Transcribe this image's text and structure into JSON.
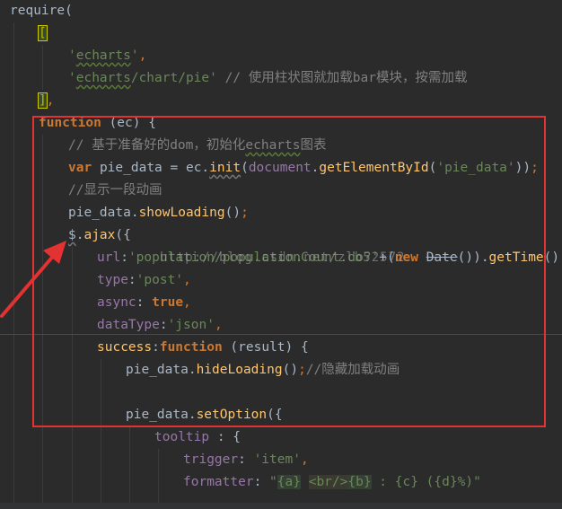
{
  "lines": [
    "require(",
    "[",
    "'echarts',",
    "'echarts/chart/pie' // 使用柱状图就加载bar模块，按需加载",
    "],",
    "function (ec) {",
    "// 基于准备好的dom，初始化echarts图表",
    "var pie_data = ec.init(document.getElementById('pie_data'));",
    "//显示一段动画",
    "pie_data.showLoading();",
    "$.ajax({",
    "url:'population/populationCount.do?'+(new Date()).getTime(),",
    "type:'post',",
    "async: true,",
    "dataType:'json',",
    "success:function (result) {",
    "pie_data.hideLoading();//隐藏加载动画",
    "",
    "pie_data.setOption({",
    "tooltip : {",
    "trigger: 'item',",
    "formatter: \"{a} <br/>{b} : {c} ({d}%)\""
  ],
  "watermark": "http://blog.csdn.net/zlb52572",
  "colors": {
    "background": "#2b2b2b",
    "keyword": "#cc7832",
    "string": "#6a8759",
    "comment": "#808080",
    "function": "#ffc66d",
    "property": "#9876aa",
    "highlight_box": "#e23232"
  }
}
